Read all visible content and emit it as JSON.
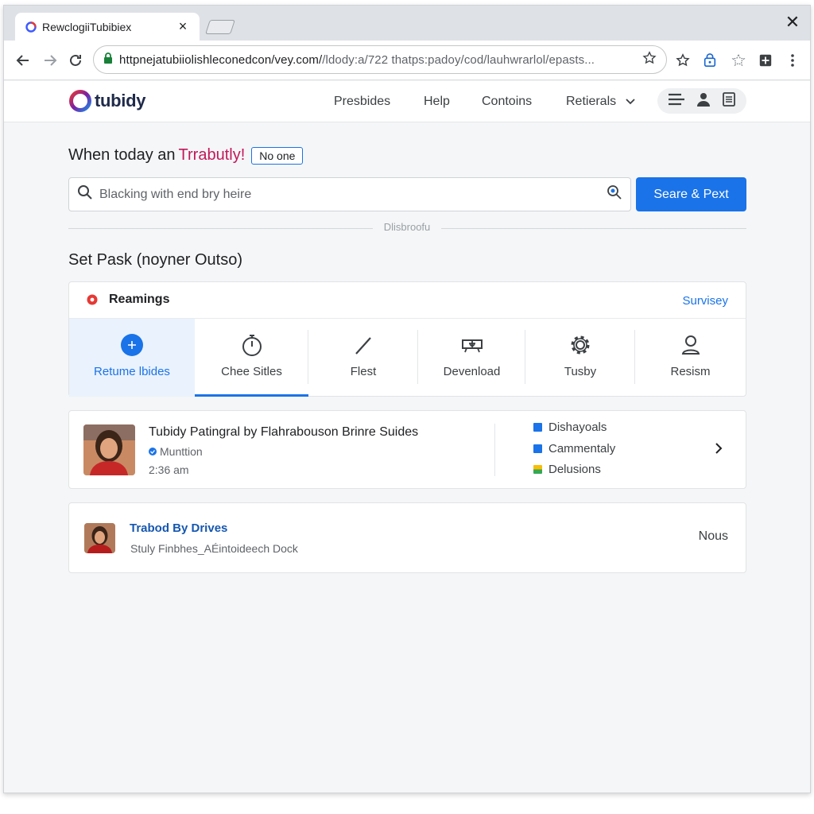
{
  "browser": {
    "tab_title": "RewclogiiTubibiex",
    "url_main": "httpnejatubiiolishleconedcon/vey.com/",
    "url_rest": "/ldody:a/722 thatps:padoy/cod/lauhwrarlol/epasts..."
  },
  "header": {
    "logo_text": "tubidy",
    "nav": [
      "Presbides",
      "Help",
      "Contoins",
      "Retierals"
    ]
  },
  "hero": {
    "prefix": "When today an",
    "accent": "Trrabutly!",
    "badge": "No one"
  },
  "search": {
    "placeholder": "Blacking with end bry heire",
    "button_label": "Seare & Pext"
  },
  "divider_label": "Dlisbroofu",
  "section_title": "Set Pask (noyner Outso)",
  "card": {
    "head_label": "Reamings",
    "head_link": "Survisey",
    "tools": [
      {
        "label": "Retume lbides",
        "icon": "plus-circle-icon"
      },
      {
        "label": "Chee Sitles",
        "icon": "timer-icon"
      },
      {
        "label": "Flest",
        "icon": "pen-icon"
      },
      {
        "label": "Devenload",
        "icon": "download-tray-icon"
      },
      {
        "label": "Tusby",
        "icon": "gear-icon"
      },
      {
        "label": "Resism",
        "icon": "user-icon"
      }
    ]
  },
  "video": {
    "title": "Tubidy Patingral by Flahrabouson Brinre Suides",
    "channel": "Munttion",
    "time": "2:36 am",
    "options": [
      {
        "label": "Dishayoals",
        "color": "#1a73e8"
      },
      {
        "label": "Cammentaly",
        "color": "#1a73e8"
      },
      {
        "label": "Delusions",
        "color": "#34a853"
      }
    ]
  },
  "item2": {
    "title": "Trabod By Drives",
    "subtitle": "Stuly Finbhes_AÉintoideech Dock",
    "right_label": "Nous"
  }
}
